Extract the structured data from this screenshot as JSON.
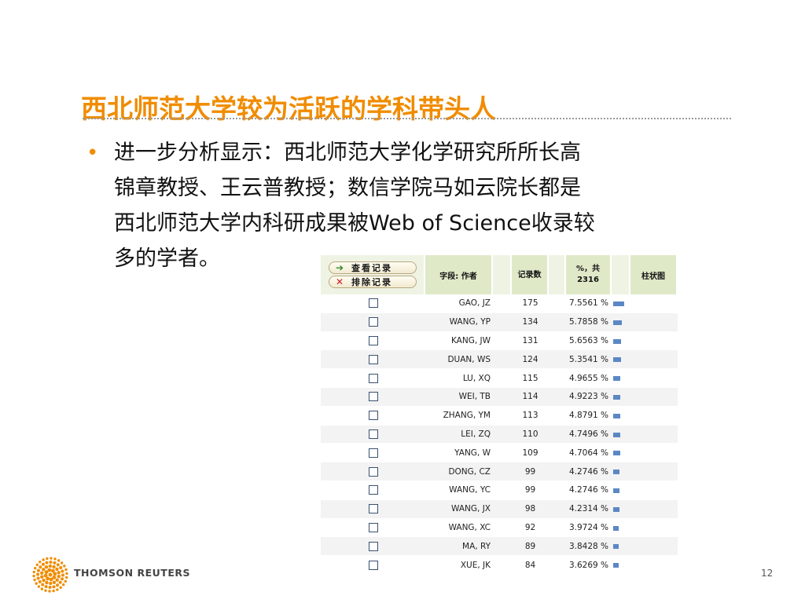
{
  "slide": {
    "title": "西北师范大学较为活跃的学科带头人",
    "bullet": "•",
    "body_lines": [
      "进一步分析显示：西北师范大学化学研究所所长高",
      "锦章教授、王云普教授；数信学院马如云院长都是",
      "西北师范大学内科研成果被Web of Science收录较",
      "多的学者。"
    ],
    "page_number": "12",
    "brand": "THOMSON REUTERS",
    "accent_color": "#f08c00"
  },
  "table": {
    "buttons": {
      "view": "查看记录",
      "exclude": "排除记录"
    },
    "headers": {
      "author": "字段: 作者",
      "count": "记录数",
      "percent": "%，共 2316",
      "chart": "柱状图"
    },
    "bar_color": "#5b87c5",
    "rows": [
      {
        "author": "GAO, JZ",
        "count": "175",
        "percent": "7.5561 %",
        "pct": 7.5561
      },
      {
        "author": "WANG, YP",
        "count": "134",
        "percent": "5.7858 %",
        "pct": 5.7858
      },
      {
        "author": "KANG, JW",
        "count": "131",
        "percent": "5.6563 %",
        "pct": 5.6563
      },
      {
        "author": "DUAN, WS",
        "count": "124",
        "percent": "5.3541 %",
        "pct": 5.3541
      },
      {
        "author": "LU, XQ",
        "count": "115",
        "percent": "4.9655 %",
        "pct": 4.9655
      },
      {
        "author": "WEI, TB",
        "count": "114",
        "percent": "4.9223 %",
        "pct": 4.9223
      },
      {
        "author": "ZHANG, YM",
        "count": "113",
        "percent": "4.8791 %",
        "pct": 4.8791
      },
      {
        "author": "LEI, ZQ",
        "count": "110",
        "percent": "4.7496 %",
        "pct": 4.7496
      },
      {
        "author": "YANG, W",
        "count": "109",
        "percent": "4.7064 %",
        "pct": 4.7064
      },
      {
        "author": "DONG, CZ",
        "count": "99",
        "percent": "4.2746 %",
        "pct": 4.2746
      },
      {
        "author": "WANG, YC",
        "count": "99",
        "percent": "4.2746 %",
        "pct": 4.2746
      },
      {
        "author": "WANG, JX",
        "count": "98",
        "percent": "4.2314 %",
        "pct": 4.2314
      },
      {
        "author": "WANG, XC",
        "count": "92",
        "percent": "3.9724 %",
        "pct": 3.9724
      },
      {
        "author": "MA, RY",
        "count": "89",
        "percent": "3.8428 %",
        "pct": 3.8428
      },
      {
        "author": "XUE, JK",
        "count": "84",
        "percent": "3.6269 %",
        "pct": 3.6269
      }
    ]
  }
}
